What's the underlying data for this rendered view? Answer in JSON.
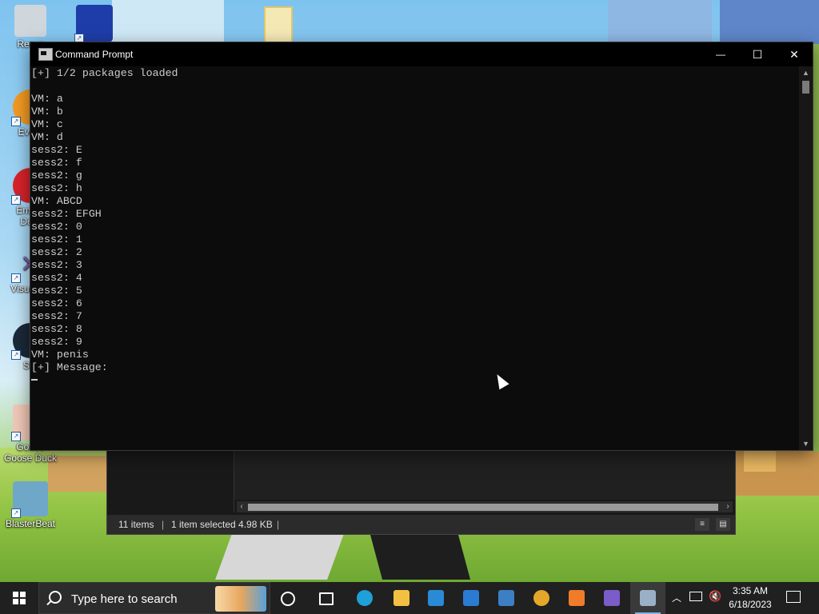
{
  "desktop": {
    "icons": [
      {
        "label": "Recyc",
        "color": "#cfd6dc"
      },
      {
        "label": "Every",
        "color": "#f29a22"
      },
      {
        "label": "Embar Dev-",
        "color": "#d8222a"
      },
      {
        "label": "Visual 20",
        "color": "#865fc5"
      },
      {
        "label": "Ste",
        "color": "#1b2838"
      },
      {
        "label": "Goose Goose Duck",
        "color": "#f1c7b7"
      },
      {
        "label": "BlasterBeat",
        "color": "#6fa7c8"
      }
    ]
  },
  "cmd": {
    "title": "Command Prompt",
    "lines": [
      "[+] 1/2 packages loaded",
      "",
      "VM: a",
      "VM: b",
      "VM: c",
      "VM: d",
      "sess2: E",
      "sess2: f",
      "sess2: g",
      "sess2: h",
      "VM: ABCD",
      "sess2: EFGH",
      "sess2: 0",
      "sess2: 1",
      "sess2: 2",
      "sess2: 3",
      "sess2: 4",
      "sess2: 5",
      "sess2: 6",
      "sess2: 7",
      "sess2: 8",
      "sess2: 9",
      "VM: penis",
      "[+] Message:"
    ],
    "minimize_glyph": "—",
    "maximize_glyph": "☐",
    "close_glyph": "✕"
  },
  "explorer": {
    "status_items": "11 items",
    "status_selected": "1 item selected  4.98 KB"
  },
  "taskbar": {
    "search_placeholder": "Type here to search",
    "time": "3:35 AM",
    "date": "6/18/2023",
    "apps": [
      {
        "name": "cortana",
        "color": "#ffffff"
      },
      {
        "name": "task-view",
        "color": "#ffffff"
      },
      {
        "name": "edge",
        "color": "#1fa0d8"
      },
      {
        "name": "file-explorer",
        "color": "#f4c042"
      },
      {
        "name": "microsoft-store",
        "color": "#2a8ad6"
      },
      {
        "name": "mail",
        "color": "#2b7bd3"
      },
      {
        "name": "photos",
        "color": "#3d7fc5"
      },
      {
        "name": "chrome",
        "color": "#e4a72a"
      },
      {
        "name": "xampp",
        "color": "#f07b2a"
      },
      {
        "name": "visual-studio",
        "color": "#7b5cc8"
      },
      {
        "name": "command-prompt",
        "color": "#9ab0c6"
      }
    ]
  }
}
